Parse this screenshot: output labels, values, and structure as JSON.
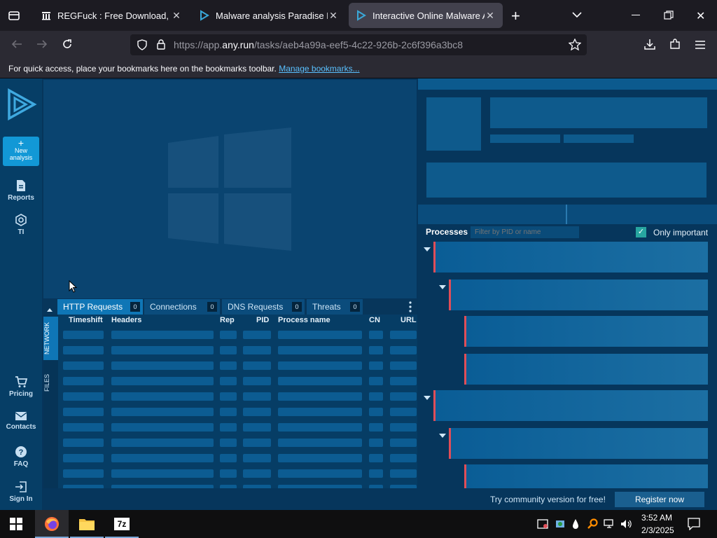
{
  "browser": {
    "tabs": [
      {
        "title": "REGFuck : Free Download, Borr",
        "active": false
      },
      {
        "title": "Malware analysis Paradise Rans",
        "active": false
      },
      {
        "title": "Interactive Online Malware Ana",
        "active": true
      }
    ],
    "url_prefix": "https://app.",
    "url_domain": "any.run",
    "url_rest": "/tasks/aeb4a99a-eef5-4c22-926b-2c6f396a3bc8",
    "bookmarks_text": "For quick access, place your bookmarks here on the bookmarks toolbar.",
    "manage_bookmarks": "Manage bookmarks..."
  },
  "sidebar": {
    "new_analysis_line1": "New",
    "new_analysis_line2": "analysis",
    "items": [
      {
        "label": "Reports"
      },
      {
        "label": "TI"
      },
      {
        "label": "Pricing"
      },
      {
        "label": "Contacts"
      },
      {
        "label": "FAQ"
      },
      {
        "label": "Sign In"
      }
    ]
  },
  "bottom_tabs": [
    {
      "label": "HTTP Requests",
      "count": "0"
    },
    {
      "label": "Connections",
      "count": "0"
    },
    {
      "label": "DNS Requests",
      "count": "0"
    },
    {
      "label": "Threats",
      "count": "0"
    }
  ],
  "side_tabs": {
    "network": "NETWORK",
    "files": "FILES"
  },
  "table_headers": [
    "Timeshift",
    "Headers",
    "Rep",
    "PID",
    "Process name",
    "CN",
    "URL"
  ],
  "processes": {
    "title": "Processes",
    "filter_placeholder": "Filter by PID or name",
    "only_important": "Only important"
  },
  "footer": {
    "community_text": "Try community version for free!",
    "register_label": "Register now"
  },
  "taskbar": {
    "time": "3:52 AM",
    "date": "2/3/2025"
  },
  "colors": {
    "accent": "#1298d6",
    "process_marker": "#e04e58"
  }
}
